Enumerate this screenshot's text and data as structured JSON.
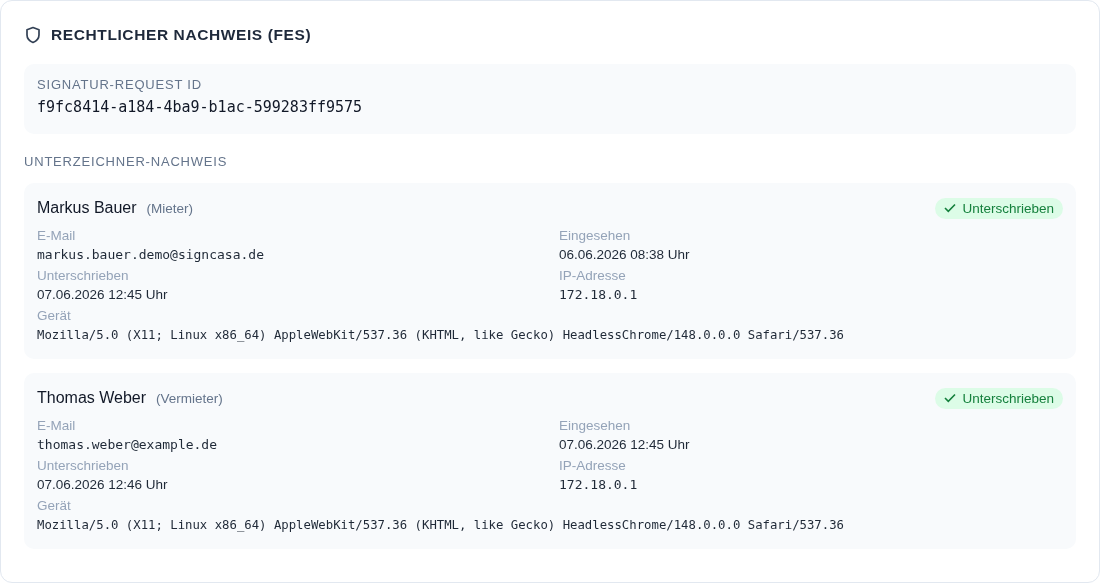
{
  "title": "RECHTLICHER NACHWEIS (FES)",
  "request": {
    "label": "SIGNATUR-REQUEST ID",
    "value": "f9fc8414-a184-4ba9-b1ac-599283ff9575"
  },
  "section_label": "UNTERZEICHNER-NACHWEIS",
  "signers": [
    {
      "name": "Markus Bauer",
      "role": "(Mieter)",
      "status": {
        "label": "Unterschrieben",
        "kind": "signed"
      },
      "fields": [
        {
          "label": "E-Mail",
          "value": "markus.bauer.demo@signcasa.de",
          "kind": "mono"
        },
        {
          "label": "Eingesehen",
          "value": "06.06.2026 08:38 Uhr",
          "kind": "text"
        },
        {
          "label": "Unterschrieben",
          "value": "07.06.2026 12:45 Uhr",
          "kind": "text"
        },
        {
          "label": "IP-Adresse",
          "value": "172.18.0.1",
          "kind": "mono"
        }
      ],
      "device": {
        "label": "Gerät",
        "value": "Mozilla/5.0 (X11; Linux x86_64) AppleWebKit/537.36 (KHTML, like Gecko) HeadlessChrome/148.0.0.0 Safari/537.36"
      }
    },
    {
      "name": "Thomas Weber",
      "role": "(Vermieter)",
      "status": {
        "label": "Unterschrieben",
        "kind": "signed"
      },
      "fields": [
        {
          "label": "E-Mail",
          "value": "thomas.weber@example.de",
          "kind": "mono"
        },
        {
          "label": "Eingesehen",
          "value": "07.06.2026 12:45 Uhr",
          "kind": "text"
        },
        {
          "label": "Unterschrieben",
          "value": "07.06.2026 12:46 Uhr",
          "kind": "text"
        },
        {
          "label": "IP-Adresse",
          "value": "172.18.0.1",
          "kind": "mono"
        }
      ],
      "device": {
        "label": "Gerät",
        "value": "Mozilla/5.0 (X11; Linux x86_64) AppleWebKit/537.36 (KHTML, like Gecko) HeadlessChrome/148.0.0.0 Safari/537.36"
      }
    }
  ]
}
